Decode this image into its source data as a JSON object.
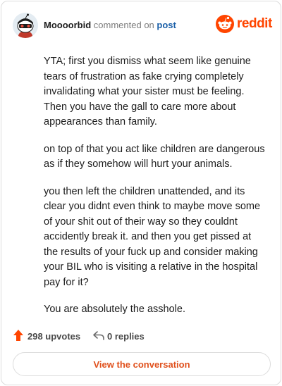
{
  "comment": {
    "username": "Moooorbid",
    "action": "commented on",
    "post_link": "post",
    "paragraphs": [
      "YTA; first you dismiss what seem like genuine tears of frustration as fake crying completely invalidating what your sister must be feeling. Then you have the gall to care more about appearances than family.",
      "on top of that you act like children are dangerous as if they somehow will hurt your animals.",
      "you then left the children unattended, and its clear you didnt even think to maybe move some of your shit out of their way so they couldnt accidently break it. and then you get pissed at the results of your fuck up and consider making your BIL who is visiting a relative in the hospital pay for it?",
      "You are absolutely the asshole."
    ]
  },
  "brand": {
    "wordmark": "reddit",
    "color": "#ff4500"
  },
  "stats": {
    "upvotes": "298 upvotes",
    "replies": "0 replies",
    "upvote_icon": "upvote-arrow-icon",
    "reply_icon": "reply-arrow-icon"
  },
  "cta": {
    "label": "View the conversation",
    "color": "#e0501c"
  }
}
